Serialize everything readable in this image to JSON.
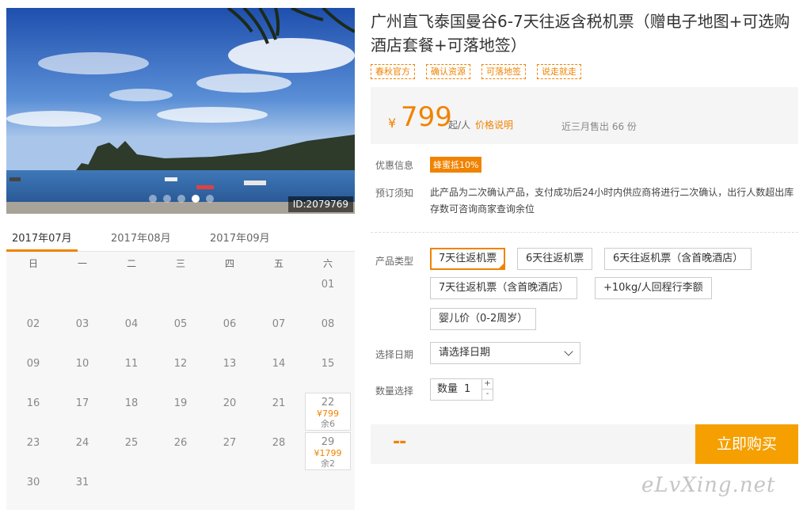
{
  "photo": {
    "id_label": "ID:2079769",
    "dots": 5,
    "active_dot": 3
  },
  "calendar": {
    "months": [
      "2017年07月",
      "2017年08月",
      "2017年09月"
    ],
    "weekdays": [
      "日",
      "一",
      "二",
      "三",
      "四",
      "五",
      "六"
    ],
    "days": [
      {
        "num": "01"
      },
      {
        "num": "02"
      },
      {
        "num": "03"
      },
      {
        "num": "04"
      },
      {
        "num": "05"
      },
      {
        "num": "06"
      },
      {
        "num": "07"
      },
      {
        "num": "08"
      },
      {
        "num": "09"
      },
      {
        "num": "10"
      },
      {
        "num": "11"
      },
      {
        "num": "12"
      },
      {
        "num": "13"
      },
      {
        "num": "14"
      },
      {
        "num": "15"
      },
      {
        "num": "16"
      },
      {
        "num": "17"
      },
      {
        "num": "18"
      },
      {
        "num": "19"
      },
      {
        "num": "20"
      },
      {
        "num": "21"
      },
      {
        "num": "22",
        "price": "¥799",
        "left": "余6"
      },
      {
        "num": "23"
      },
      {
        "num": "24"
      },
      {
        "num": "25"
      },
      {
        "num": "26"
      },
      {
        "num": "27"
      },
      {
        "num": "28"
      },
      {
        "num": "29",
        "price": "¥1799",
        "left": "余2"
      },
      {
        "num": "30"
      },
      {
        "num": "31"
      }
    ]
  },
  "product": {
    "title": "广州直飞泰国曼谷6-7天往返含税机票（赠电子地图+可选购酒店套餐+可落地签）",
    "tags": [
      "春秋官方",
      "确认资源",
      "可落地签",
      "说走就走"
    ],
    "currency": "¥",
    "price": "799",
    "per": "起/人",
    "price_note": "价格说明",
    "sold": "近三月售出 66 份"
  },
  "labels": {
    "discount": "优惠信息",
    "booking": "预订须知",
    "type": "产品类型",
    "date": "选择日期",
    "qty": "数量选择"
  },
  "discount_badge": "蜂蜜抵10%",
  "booking_note": "此产品为二次确认产品，支付成功后24小时内供应商将进行二次确认，出行人数超出库存数可咨询商家查询余位",
  "options": [
    "7天往返机票",
    "6天往返机票",
    "6天往返机票（含首晚酒店）",
    "7天往返机票（含首晚酒店）",
    "+10kg/人回程行李额",
    "婴儿价（0-2周岁）"
  ],
  "date_select": "请选择日期",
  "qty": {
    "label": "数量",
    "value": "1",
    "plus": "+",
    "minus": "-"
  },
  "total": "--",
  "buy_button": "立即购买",
  "watermark": "eLvXing.net",
  "colors": {
    "accent": "#f08300",
    "button": "#f5a000"
  }
}
